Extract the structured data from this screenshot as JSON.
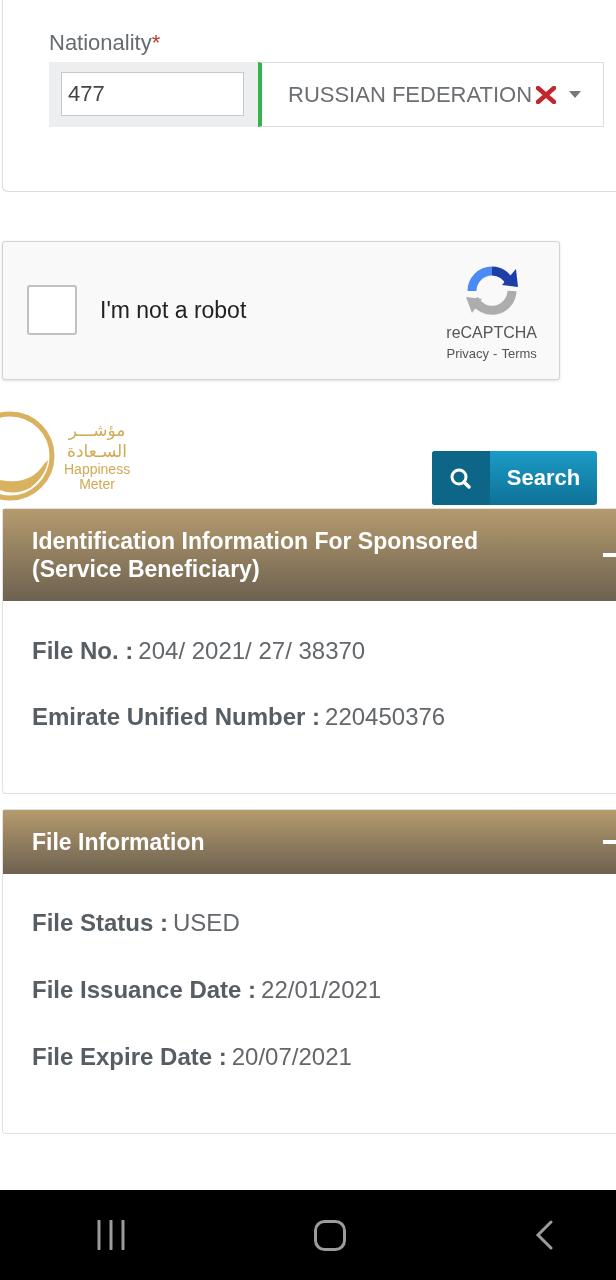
{
  "nationality_field": {
    "label": "Nationality",
    "required_mark": "*",
    "code": "477",
    "value": "RUSSIAN FEDERATION",
    "valid": true
  },
  "captcha": {
    "label": "I'm not a robot",
    "checked": false,
    "brand": "reCAPTCHA",
    "privacy_link": "Privacy",
    "separator": "-",
    "terms_link": "Terms"
  },
  "logo": {
    "arabic_lines": [
      "مؤشـــر",
      "السـعادة"
    ],
    "english_lines": [
      "Happiness",
      "Meter"
    ]
  },
  "search_button": {
    "label": "Search"
  },
  "panels": [
    {
      "title": "Identification Information For Sponsored (Service Beneficiary)",
      "expanded": true,
      "fields": [
        {
          "label": "File No. :",
          "value": "204/ 2021/ 27/ 38370"
        },
        {
          "label": "Emirate Unified Number :",
          "value": "220450376"
        }
      ]
    },
    {
      "title": "File Information",
      "expanded": true,
      "fields": [
        {
          "label": "File Status :",
          "value": "USED"
        },
        {
          "label": "File Issuance Date :",
          "value": "22/01/2021"
        },
        {
          "label": "File Expire Date :",
          "value": "20/07/2021"
        }
      ]
    }
  ]
}
